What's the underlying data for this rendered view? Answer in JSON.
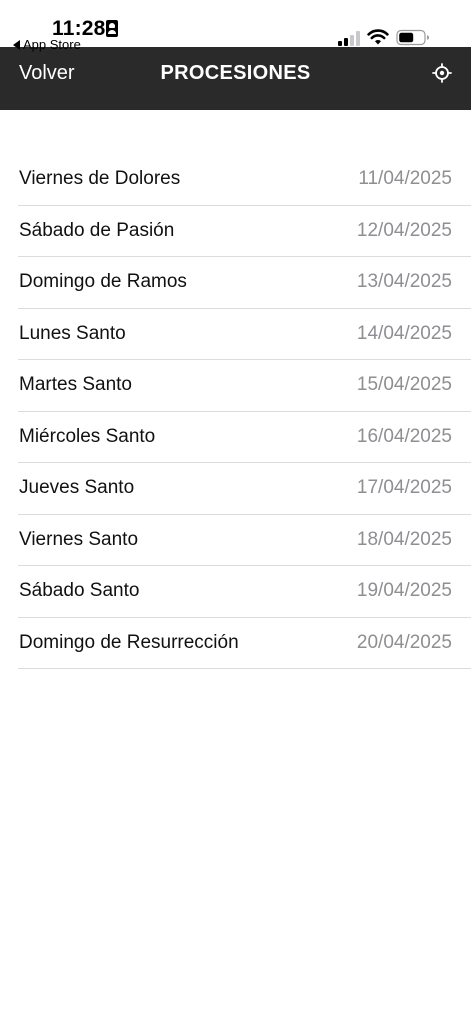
{
  "status_bar": {
    "time": "11:28",
    "back_app": "App Store"
  },
  "nav": {
    "back_label": "Volver",
    "title": "PROCESIONES",
    "action_icon": "location-target-icon"
  },
  "processions": [
    {
      "name": "Viernes de Dolores",
      "date": "11/04/2025"
    },
    {
      "name": "Sábado de Pasión",
      "date": "12/04/2025"
    },
    {
      "name": "Domingo de Ramos",
      "date": "13/04/2025"
    },
    {
      "name": "Lunes Santo",
      "date": "14/04/2025"
    },
    {
      "name": "Martes Santo",
      "date": "15/04/2025"
    },
    {
      "name": "Miércoles Santo",
      "date": "16/04/2025"
    },
    {
      "name": "Jueves Santo",
      "date": "17/04/2025"
    },
    {
      "name": "Viernes Santo",
      "date": "18/04/2025"
    },
    {
      "name": "Sábado Santo",
      "date": "19/04/2025"
    },
    {
      "name": "Domingo de Resurrección",
      "date": "20/04/2025"
    }
  ],
  "colors": {
    "nav_background": "#2a2a2a",
    "nav_text": "#ffffff",
    "row_text": "#111111",
    "date_text": "#8e8e93",
    "separator": "#dcdcdc"
  }
}
